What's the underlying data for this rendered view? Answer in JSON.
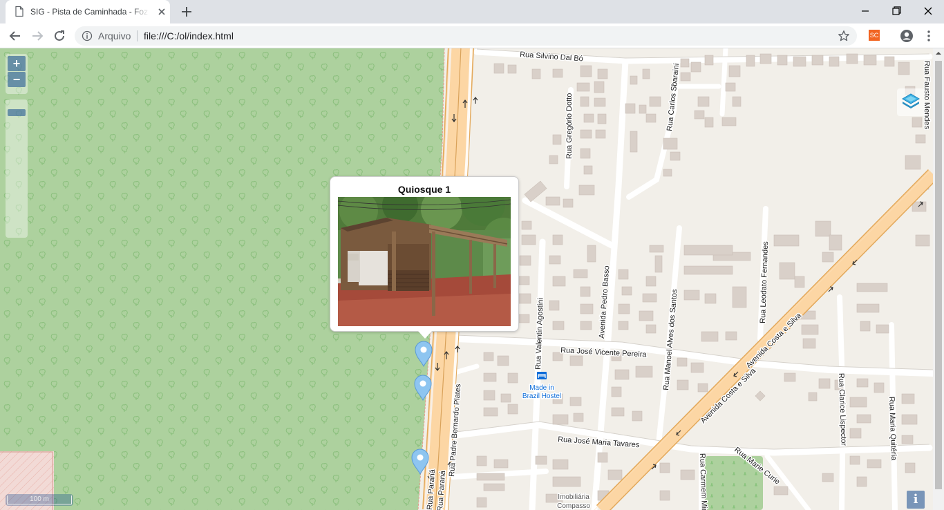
{
  "browser": {
    "tab_title": "SIG - Pista de Caminhada - Foz do Iguaçu",
    "new_tab_icon": "plus-icon",
    "address_scheme": "Arquivo",
    "address_url": "file:///C:/ol/index.html",
    "extension_badge": "SC"
  },
  "map": {
    "zoom_in_label": "+",
    "zoom_out_label": "−",
    "scale_label": "100 m",
    "info_label": "i",
    "layer_switcher_icon": "layers-icon",
    "colors": {
      "park": "#add19e",
      "land": "#f2efe9",
      "main_road": "#fcd6a4",
      "building": "#d9d0c9",
      "marker": "#8ec5f0"
    },
    "street_labels": [
      "Rua Silvino Dal Bó",
      "Rua Fausto Mendes",
      "Rua Gregório Dotto",
      "Rua Carlos Sbaraini",
      "Rua Leodato Fernandes",
      "Avenida Costa e Silva",
      "Avenida Costa e Silva",
      "Rua Valentin Agostini",
      "Avenida Pedro Basso",
      "Rua Manoel Alves dos Santos",
      "Rua José Vicente Pereira",
      "Rua Padre Bernardo Plates",
      "Rua José Maria Tavares",
      "Rua Clarice Lispector",
      "Rua Maria Quitéria",
      "Rua Marie Curie",
      "Rua Carmem Miranda",
      "Rua Paraná",
      "Rua Paraná"
    ],
    "poi_labels": [
      "Made in",
      "Brazil Hostel",
      "Imobiliária",
      "Compasso"
    ],
    "popup": {
      "title": "Quiosque 1"
    },
    "markers": [
      {
        "name": "marker-1"
      },
      {
        "name": "marker-2"
      },
      {
        "name": "marker-3"
      }
    ]
  }
}
